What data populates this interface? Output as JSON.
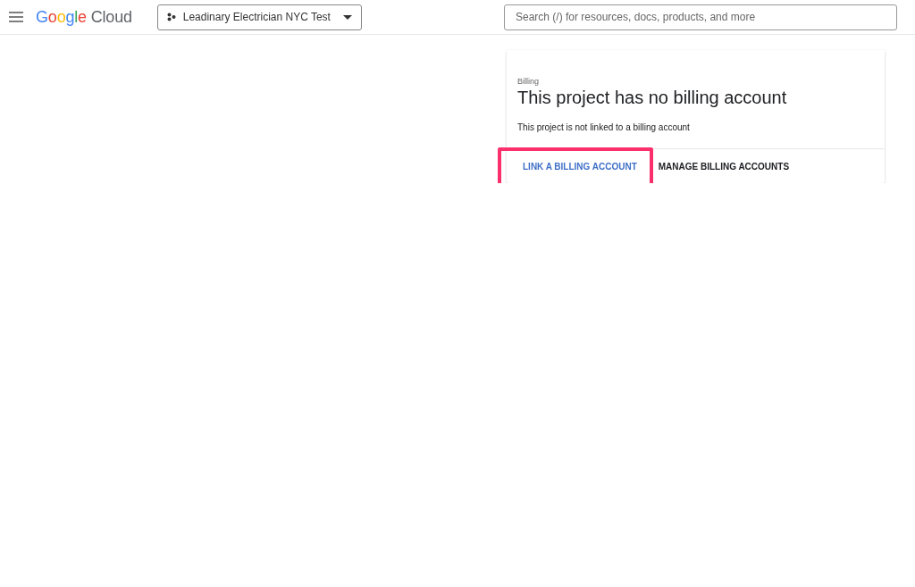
{
  "header": {
    "logo": "Google Cloud",
    "project": "Leadinary Electrician NYC Test",
    "search": {
      "placeholder": "Search (/) for resources, docs, products, and more"
    }
  },
  "card": {
    "overline": "Billing",
    "title": "This project has no billing account",
    "body": "This project is not linked to a billing account",
    "actions": [
      {
        "label": "LINK A BILLING ACCOUNT",
        "kind": "primary",
        "highlighted": true
      },
      {
        "label": "MANAGE BILLING ACCOUNTS",
        "kind": "default",
        "highlighted": false
      }
    ]
  }
}
